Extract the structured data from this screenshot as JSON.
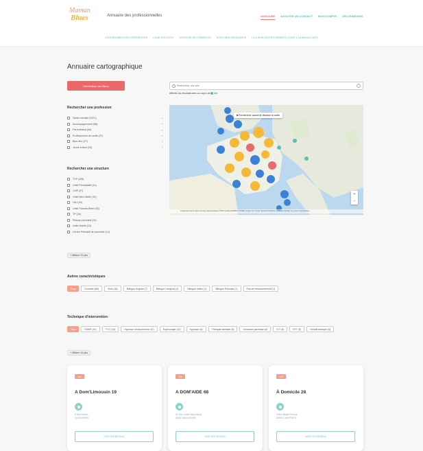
{
  "brand": {
    "logo_line1": "Maman",
    "logo_line2": "Blues",
    "title": "Annuaire des professionnelles"
  },
  "topnav": [
    "ANNUAIRE",
    "AJOUTER UN CONTACT",
    "MON COMPTE",
    "DÉCONNEXION"
  ],
  "subnav": [
    "COORDONNÉES DES RÉFÉRENTES",
    "LIGNE D'ÉCOUTE",
    "SESSIONS DE FORMATION",
    "SITES WEB RESSOURCE",
    "LA & RENCONTRES PARENTS (CAFÉ & LA MAIN À CAFÉ)"
  ],
  "page_title": "Annuaire cartographique",
  "reset_button": "Réinitialiser les filtres",
  "search": {
    "placeholder": "Rechercher une ville"
  },
  "map_hint": "Afficher les résultats dans un rayon de",
  "map_hint_unit": "km",
  "profession": {
    "title": "Rechercher une profession",
    "items": [
      "Santé mentale (1021)",
      "Accompagnement (98)",
      "Paramédical (84)",
      "Professionnel de santé (47)",
      "Bien-être (27)",
      "Jeune enfant (33)"
    ]
  },
  "structure": {
    "title": "Rechercher une structure",
    "items": [
      "TVP (155)",
      "Unité Périnatalité (41)",
      "CMP (37)",
      "Unité Mère-Bébé (33)",
      "HDJ (30)",
      "Unité Parents-Bébé (33)",
      "TP (26)",
      "Réseau périnatal (24)",
      "Unité Mobile (22)",
      "Centre Périnatal de proximité (14)"
    ],
    "show_more": "+ Afficher 20 plus"
  },
  "map": {
    "tooltip": "Rechercher quand je déplace la carte",
    "zoom_in": "+",
    "zoom_out": "−",
    "footer": "Google   Raccourcis clavier   Données cartographiques ©2023 GeoBasis-DE/BKG (©2009), Google, Inst. Geogr. Nacional   Conditions d'utilisation   Signaler une erreur cartographique"
  },
  "other": {
    "title": "Autres caractéristiques",
    "chips": [
      "Tous",
      "Domicile (66)",
      "Visio (46)",
      "Bilingue Anglais (7)",
      "Bilingue Hongrois (1)",
      "Bilingue Italien (1)",
      "Bilingue Polonais (1)",
      "Pas de remboursement (1)"
    ]
  },
  "technique": {
    "title": "Technique d'intervention",
    "chips": [
      "Tous",
      "EMDR (31)",
      "TCC (14)",
      "Hypnose ericksonienne (11)",
      "Sophrologie (10)",
      "Hypnose (8)",
      "Thérapie familiale (8)",
      "Guidance parentale (6)",
      "ICV (5)",
      "EFT (5)",
      "Gestalt thérapie (5)"
    ],
    "show_more": "+ Afficher 10 plus"
  },
  "cards": [
    {
      "badge": "TVP",
      "name": "A Dom'Limousin 19",
      "addr1": "2 Rue Dante",
      "addr2": "19100 BRIVE",
      "button": "VOIR LES DÉTAILS"
    },
    {
      "badge": "TVP",
      "name": "A DOM'AIDE 68",
      "addr1": "21 Rue Victor Schoelcher",
      "addr2": "68200 MULHOUSE",
      "button": "VOIR LES DÉTAILS"
    },
    {
      "badge": "TVP",
      "name": "À Domicile 28",
      "addr1": "4 Rue Blaise Pascal",
      "addr2": "28000 CHARTRES",
      "button": "VOIR LES DÉTAILS"
    }
  ],
  "colors": {
    "accent": "#e96a6a",
    "teal": "#5fbdb8",
    "cluster_yellow": "#f5b93a",
    "cluster_blue": "#3b82d6",
    "cluster_red": "#e96a6a"
  }
}
